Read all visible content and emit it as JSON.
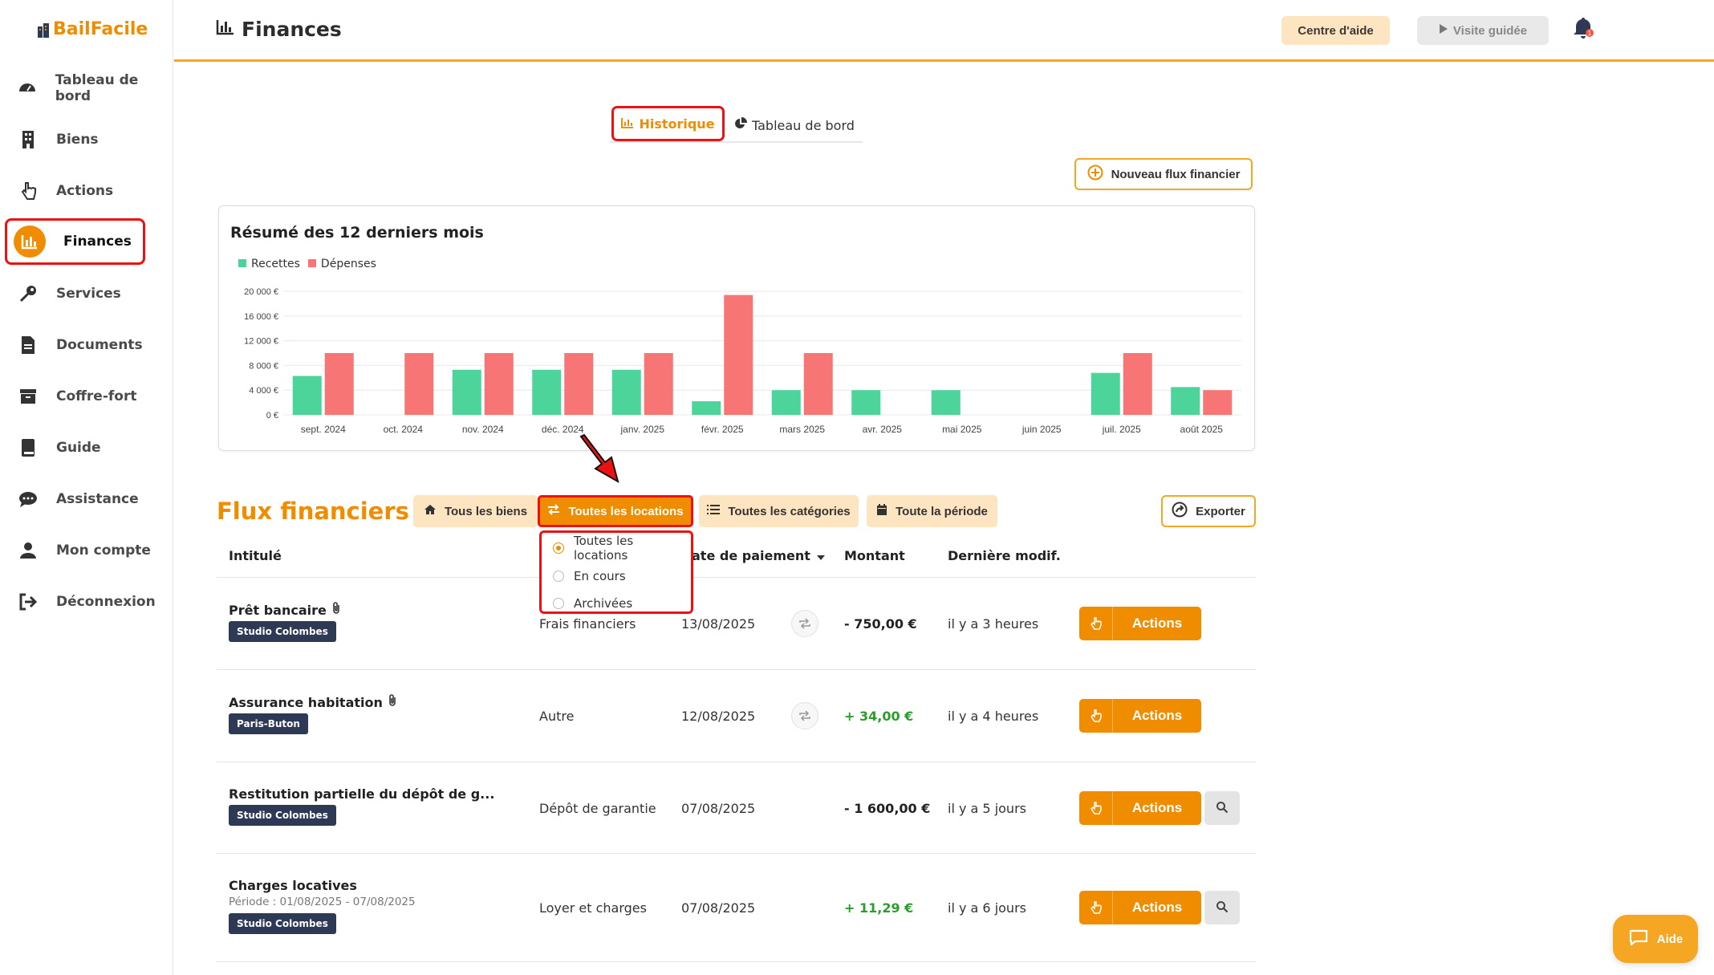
{
  "app": {
    "logo": "BailFacile"
  },
  "sidebar": {
    "items": [
      {
        "label": "Tableau de bord",
        "icon": "dashboard-gauge-icon"
      },
      {
        "label": "Biens",
        "icon": "building-icon"
      },
      {
        "label": "Actions",
        "icon": "hand-pointer-icon"
      },
      {
        "label": "Finances",
        "icon": "bar-chart-icon",
        "active": true
      },
      {
        "label": "Services",
        "icon": "key-icon"
      },
      {
        "label": "Documents",
        "icon": "file-icon"
      },
      {
        "label": "Coffre-fort",
        "icon": "archive-box-icon"
      },
      {
        "label": "Guide",
        "icon": "book-icon"
      },
      {
        "label": "Assistance",
        "icon": "chat-bubble-icon"
      },
      {
        "label": "Mon compte",
        "icon": "user-icon"
      },
      {
        "label": "Déconnexion",
        "icon": "logout-icon"
      }
    ]
  },
  "header": {
    "title": "Finances",
    "help_label": "Centre d'aide",
    "tour_label": "Visite guidée",
    "notification_count": "1"
  },
  "tabs": {
    "historique": "Historique",
    "dashboard": "Tableau de bord"
  },
  "new_flux_label": "Nouveau flux financier",
  "chart_data": {
    "type": "bar",
    "title": "Résumé des 12 derniers mois",
    "categories": [
      "sept. 2024",
      "oct. 2024",
      "nov. 2024",
      "déc. 2024",
      "janv. 2025",
      "févr. 2025",
      "mars 2025",
      "avr. 2025",
      "mai 2025",
      "juin 2025",
      "juil. 2025",
      "août 2025"
    ],
    "series": [
      {
        "name": "Recettes",
        "color": "#4cd49b",
        "values": [
          6300,
          0,
          7300,
          7300,
          7300,
          2200,
          4000,
          4000,
          4000,
          0,
          6800,
          4500
        ]
      },
      {
        "name": "Dépenses",
        "color": "#f87575",
        "values": [
          10000,
          10000,
          10000,
          10000,
          10000,
          19400,
          10000,
          0,
          0,
          0,
          10000,
          4000
        ]
      }
    ],
    "yticks": [
      "0 €",
      "4 000 €",
      "8 000 €",
      "12 000 €",
      "16 000 €",
      "20 000 €"
    ],
    "ylim": [
      0,
      20000
    ],
    "legend": "top-left",
    "grid": true
  },
  "flux": {
    "title": "Flux financiers",
    "filters": {
      "biens": "Tous les biens",
      "locations": "Toutes les locations",
      "categories": "Toutes les catégories",
      "periode": "Toute la période"
    },
    "export_label": "Exporter",
    "dropdown": {
      "options": [
        "Toutes les locations",
        "En cours",
        "Archivées"
      ],
      "selected": "Toutes les locations"
    },
    "columns": {
      "intitule": "Intitulé",
      "date": "Date de paiement",
      "date_visible": "ate de paiement",
      "montant": "Montant",
      "modif": "Dernière modif."
    },
    "rows": [
      {
        "title": "Prêt bancaire",
        "subtitle": "",
        "badge": "Studio Colombes",
        "category": "Frais financiers",
        "date": "13/08/2025",
        "amount": "- 750,00 €",
        "positive": false,
        "modified": "il y a 3 heures",
        "action": "Actions"
      },
      {
        "title": "Assurance habitation",
        "subtitle": "",
        "badge": "Paris-Buton",
        "category": "Autre",
        "date": "12/08/2025",
        "amount": "+ 34,00 €",
        "positive": true,
        "modified": "il y a 4 heures",
        "action": "Actions"
      },
      {
        "title": "Restitution partielle du dépôt de g...",
        "subtitle": "",
        "badge": "Studio Colombes",
        "category": "Dépôt de garantie",
        "date": "07/08/2025",
        "amount": "- 1 600,00 €",
        "positive": false,
        "modified": "il y a 5 jours",
        "action": "Actions"
      },
      {
        "title": "Charges locatives",
        "subtitle": "Période : 01/08/2025 - 07/08/2025",
        "badge": "Studio Colombes",
        "category": "Loyer et charges",
        "date": "07/08/2025",
        "amount": "+ 11,29 €",
        "positive": true,
        "modified": "il y a 6 jours",
        "action": "Actions"
      }
    ]
  },
  "aide_label": "Aide"
}
